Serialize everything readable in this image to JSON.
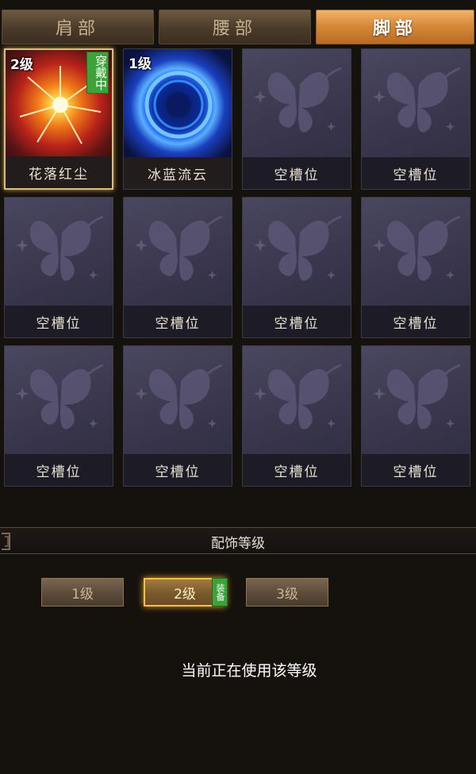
{
  "tabs": [
    {
      "label": "肩部",
      "active": false
    },
    {
      "label": "腰部",
      "active": false
    },
    {
      "label": "脚部",
      "active": true
    }
  ],
  "slots": [
    {
      "name": "花落红尘",
      "level": "2级",
      "equipped_tag": "穿戴中",
      "art": "fire",
      "selected": true
    },
    {
      "name": "冰蓝流云",
      "level": "1级",
      "art": "ice"
    },
    {
      "name": "空槽位"
    },
    {
      "name": "空槽位"
    },
    {
      "name": "空槽位"
    },
    {
      "name": "空槽位"
    },
    {
      "name": "空槽位"
    },
    {
      "name": "空槽位"
    },
    {
      "name": "空槽位"
    },
    {
      "name": "空槽位"
    },
    {
      "name": "空槽位"
    },
    {
      "name": "空槽位"
    }
  ],
  "section": {
    "title": "配饰等级"
  },
  "level_buttons": [
    {
      "label": "1级",
      "selected": false
    },
    {
      "label": "2级",
      "selected": true,
      "badge": "装备"
    },
    {
      "label": "3级",
      "selected": false
    }
  ],
  "status": "当前正在使用该等级",
  "colors": {
    "accent": "#d88a3a",
    "equip_green": "#3da23a",
    "slot_bg": "#3b3850"
  },
  "icons": {
    "empty_slot": "butterfly-icon"
  }
}
